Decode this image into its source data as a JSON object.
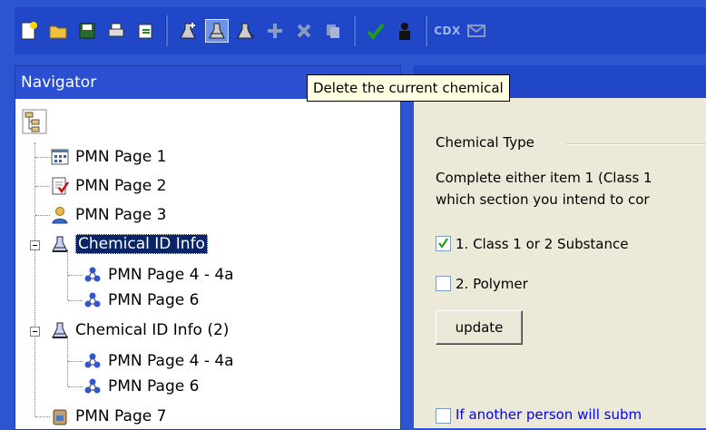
{
  "toolbar": {
    "buttons": [
      {
        "icon": "new-document-icon"
      },
      {
        "icon": "open-folder-icon"
      },
      {
        "icon": "save-icon"
      },
      {
        "icon": "print-icon"
      },
      {
        "icon": "export-icon"
      },
      {
        "icon": "add-chemical-icon"
      },
      {
        "icon": "delete-chemical-icon",
        "active": true
      },
      {
        "icon": "chemical-icon"
      },
      {
        "icon": "add-icon"
      },
      {
        "icon": "remove-icon"
      },
      {
        "icon": "copy-icon"
      },
      {
        "icon": "validate-icon"
      },
      {
        "icon": "user-icon"
      },
      {
        "icon": "cdx-icon"
      },
      {
        "icon": "mail-icon"
      }
    ],
    "cdx_label": "CDX"
  },
  "navigator": {
    "title": "Navigator",
    "tree": [
      {
        "label": "PMN Page 1",
        "icon": "grid-page-icon"
      },
      {
        "label": "PMN Page 2",
        "icon": "checked-page-icon"
      },
      {
        "label": "PMN Page 3",
        "icon": "person-icon"
      },
      {
        "label": "Chemical ID Info",
        "icon": "flask-icon",
        "selected": true,
        "expanded": true
      },
      {
        "label": "PMN Page 4 - 4a",
        "icon": "molecule-icon"
      },
      {
        "label": "PMN Page 6",
        "icon": "molecule-icon"
      },
      {
        "label": "Chemical ID Info (2)",
        "icon": "flask-icon",
        "expanded": true
      },
      {
        "label": "PMN Page 4 - 4a",
        "icon": "molecule-icon"
      },
      {
        "label": "PMN Page 6",
        "icon": "molecule-icon"
      },
      {
        "label": "PMN Page 7",
        "icon": "container-icon"
      }
    ]
  },
  "tooltip": "Delete the current chemical",
  "panel": {
    "group_title": "Chemical Type",
    "desc_line1": "Complete either item 1 (Class 1",
    "desc_line2": "which section you intend to cor",
    "option1": "1. Class 1 or 2 Substance",
    "option1_checked": true,
    "option2": "2. Polymer",
    "option2_checked": false,
    "update_label": "update",
    "another_person": "If another person will subm"
  }
}
